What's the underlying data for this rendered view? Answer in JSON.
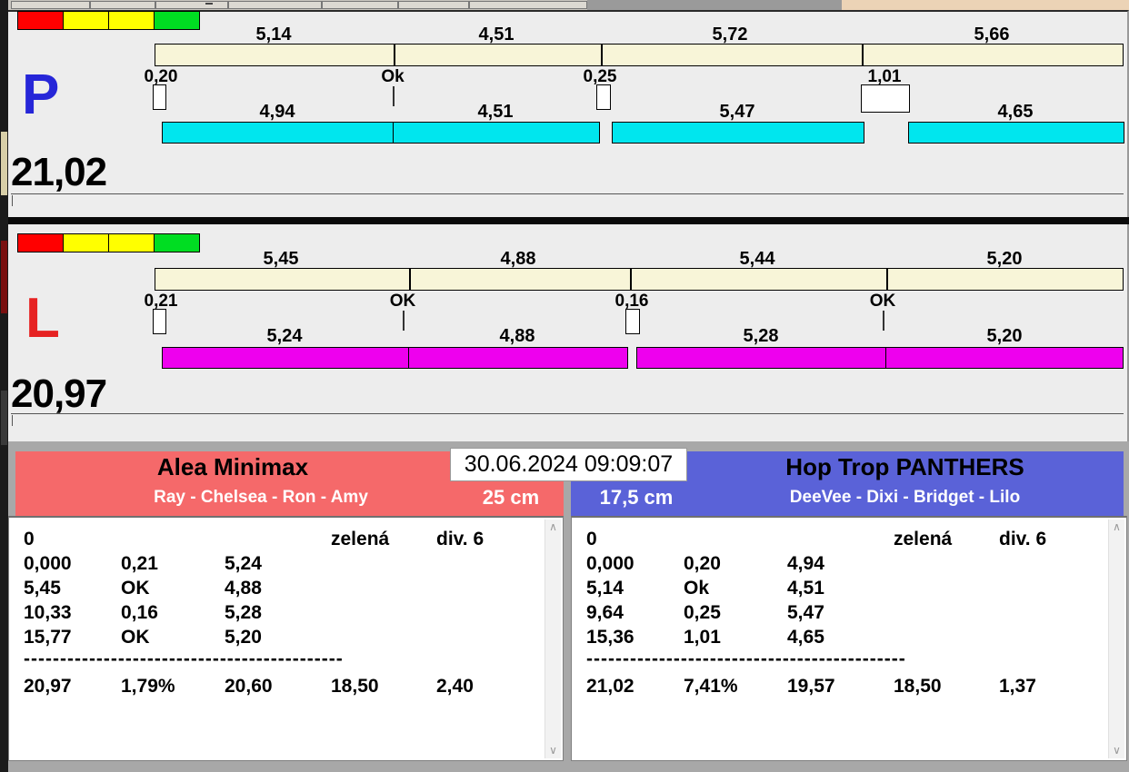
{
  "timestamp": "30.06.2024 09:09:07",
  "panel_p": {
    "letter": "P",
    "letter_color": "#2626d8",
    "total": "21,02",
    "bar_color": "#00e6ee",
    "target_bar_color": "#f8f5d8",
    "legend_colors": [
      "#ff0000",
      "#ffff00",
      "#ffff00",
      "#00dd22"
    ],
    "target_labels": [
      "5,14",
      "4,51",
      "5,72",
      "5,66"
    ],
    "checkpoints": [
      {
        "label": "0,20"
      },
      {
        "label": "Ok"
      },
      {
        "label": "0,25"
      },
      {
        "label": "1,01"
      }
    ],
    "actual_labels": [
      "4,94",
      "4,51",
      "5,47",
      "4,65"
    ]
  },
  "panel_l": {
    "letter": "L",
    "letter_color": "#e62222",
    "total": "20,97",
    "bar_color": "#ee00ee",
    "target_bar_color": "#f8f5d8",
    "legend_colors": [
      "#ff0000",
      "#ffff00",
      "#ffff00",
      "#00dd22"
    ],
    "target_labels": [
      "5,45",
      "4,88",
      "5,44",
      "5,20"
    ],
    "checkpoints": [
      {
        "label": "0,21"
      },
      {
        "label": "OK"
      },
      {
        "label": "0,16"
      },
      {
        "label": "OK"
      }
    ],
    "actual_labels": [
      "5,24",
      "4,88",
      "5,28",
      "5,20"
    ]
  },
  "team_left": {
    "name": "Alea Minimax",
    "players": "Ray - Chelsea - Ron - Amy",
    "distance": "25 cm",
    "header_color": "#f5696a",
    "info_row": {
      "col1": "0",
      "col4": "zelená",
      "col5": "div. 6"
    },
    "rows": [
      [
        "0,000",
        "0,21",
        "5,24"
      ],
      [
        "5,45",
        "OK",
        "4,88"
      ],
      [
        "10,33",
        "0,16",
        "5,28"
      ],
      [
        "15,77",
        "OK",
        "5,20"
      ]
    ],
    "separator": "--------------------------------------------",
    "summary": [
      "20,97",
      "1,79%",
      "20,60",
      "18,50",
      "2,40"
    ]
  },
  "team_right": {
    "name": "Hop Trop PANTHERS",
    "players": "DeeVee - Dixi - Bridget - Lilo",
    "distance": "17,5 cm",
    "header_color": "#5a62d8",
    "info_row": {
      "col1": "0",
      "col4": "zelená",
      "col5": "div. 6"
    },
    "rows": [
      [
        "0,000",
        "0,20",
        "4,94"
      ],
      [
        "5,14",
        "Ok",
        "4,51"
      ],
      [
        "9,64",
        "0,25",
        "5,47"
      ],
      [
        "15,36",
        "1,01",
        "4,65"
      ]
    ],
    "separator": "--------------------------------------------",
    "summary": [
      "21,02",
      "7,41%",
      "19,57",
      "18,50",
      "1,37"
    ]
  }
}
